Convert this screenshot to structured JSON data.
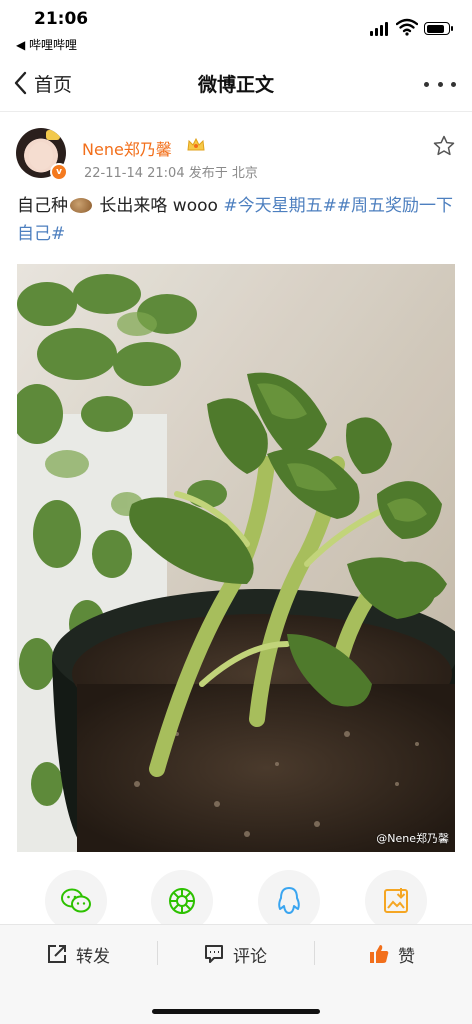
{
  "status_bar": {
    "time": "21:06",
    "back_app": "◀ 哔哩哔哩",
    "battery_level": 0.85
  },
  "nav": {
    "back_label": "首页",
    "title": "微博正文",
    "more_icon": "more-dots-icon"
  },
  "post": {
    "username": "Nene郑乃馨",
    "username_color": "#f26f1b",
    "verified_badge": "v",
    "meta": "22-11-14 21:04  发布于 北京",
    "text_before": "自己种",
    "text_after": " 长出来咯 wooo ",
    "hashtags": "#今天星期五##周五奖励一下自己#",
    "hashtag_color": "#4d7fbf",
    "image_watermark": "@Nene郑乃馨"
  },
  "share": {
    "items": [
      {
        "icon": "wechat-icon",
        "color": "#2dc100"
      },
      {
        "icon": "moments-icon",
        "color": "#2dc100"
      },
      {
        "icon": "qq-icon",
        "color": "#3aa5f0"
      },
      {
        "icon": "save-image-icon",
        "color": "#f5a623"
      }
    ]
  },
  "actions": {
    "repost": "转发",
    "comment": "评论",
    "like": "赞",
    "like_color": "#f26f1b"
  }
}
